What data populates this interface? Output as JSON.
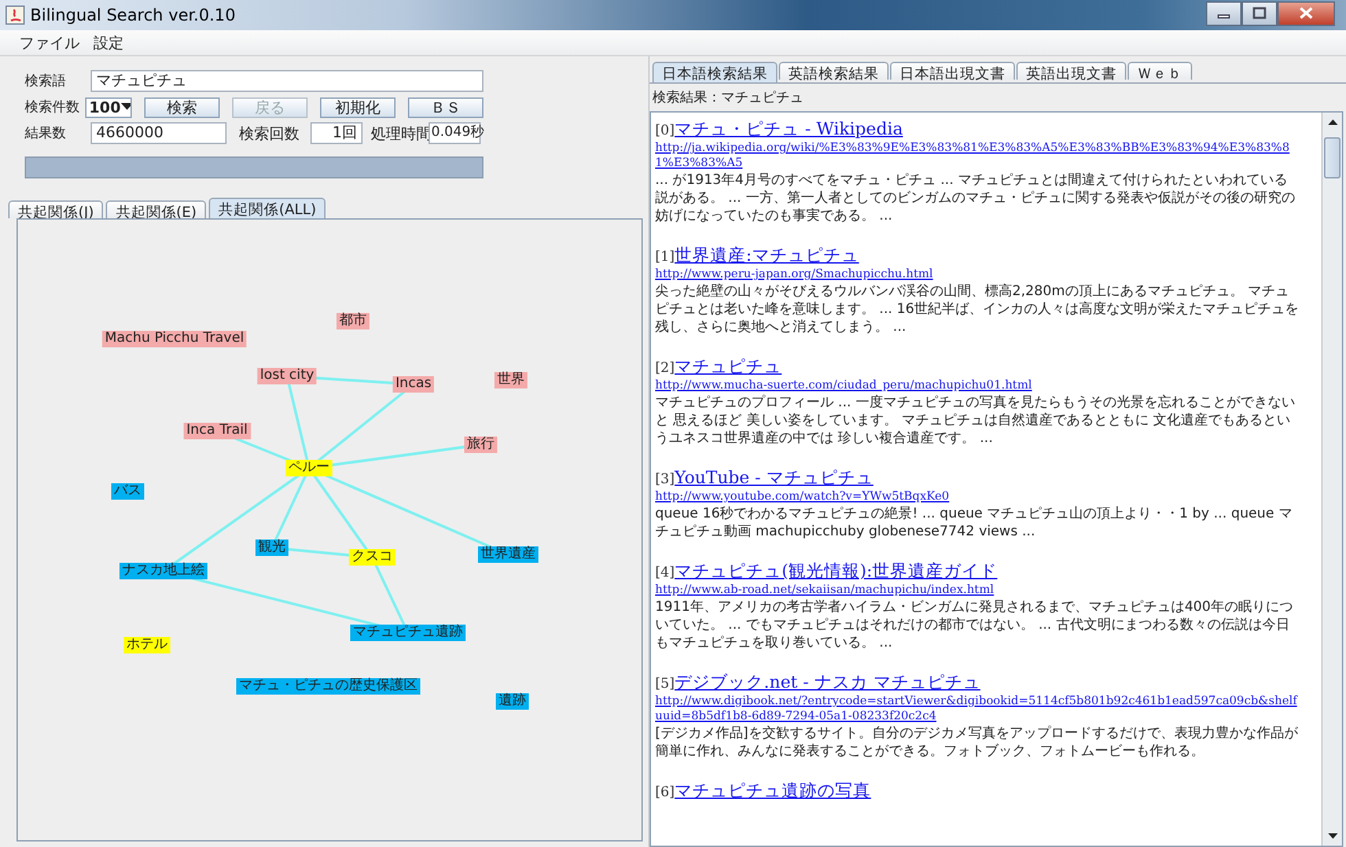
{
  "window": {
    "title": "Bilingual Search ver.0.10"
  },
  "menu": [
    "ファイル",
    "設定"
  ],
  "form": {
    "query_label": "検索語",
    "query": "マチュピチュ",
    "count_label": "検索件数",
    "count": "100",
    "buttons": [
      {
        "label": "検索",
        "disabled": false
      },
      {
        "label": "戻る",
        "disabled": true
      },
      {
        "label": "初期化",
        "disabled": false
      },
      {
        "label": "ＢＳ",
        "disabled": false
      }
    ],
    "results_label": "結果数",
    "results": "4660000",
    "searches_label": "検索回数",
    "searches": "1回",
    "time_label": "処理時間",
    "time": "0.049秒",
    "progress": {
      "level": 1
    }
  },
  "graph_tabs": [
    {
      "label": "共起関係(J)",
      "selected": false
    },
    {
      "label": "共起関係(E)",
      "selected": false
    },
    {
      "label": "共起関係(ALL)",
      "selected": true
    }
  ],
  "graph_nodes": [
    {
      "label": "Machu Picchu Travel",
      "color": "#f4aaaa"
    },
    {
      "label": "都市",
      "color": "#f4aaaa"
    },
    {
      "label": "lost city",
      "color": "#f4aaaa"
    },
    {
      "label": "Incas",
      "color": "#f4aaaa"
    },
    {
      "label": "世界",
      "color": "#f4aaaa"
    },
    {
      "label": "Inca Trail",
      "color": "#f4aaaa"
    },
    {
      "label": "旅行",
      "color": "#f4aaaa"
    },
    {
      "label": "ペルー",
      "color": "#ffff00"
    },
    {
      "label": "バス",
      "color": "#00b0f0"
    },
    {
      "label": "観光",
      "color": "#00b0f0"
    },
    {
      "label": "クスコ",
      "color": "#ffff00"
    },
    {
      "label": "世界遺産",
      "color": "#00b0f0"
    },
    {
      "label": "ナスカ地上絵",
      "color": "#00b0f0"
    },
    {
      "label": "マチュピチュ遺跡",
      "color": "#00b0f0"
    },
    {
      "label": "ホテル",
      "color": "#ffff00"
    },
    {
      "label": "マチュ・ピチュの歴史保護区",
      "color": "#00b0f0"
    },
    {
      "label": "遺跡",
      "color": "#00b0f0"
    }
  ],
  "result_tabs": [
    {
      "label": "日本語検索結果",
      "selected": true
    },
    {
      "label": "英語検索結果",
      "selected": false
    },
    {
      "label": "日本語出現文書",
      "selected": false
    },
    {
      "label": "英語出現文書",
      "selected": false
    },
    {
      "label": "Ｗｅｂ",
      "selected": false
    }
  ],
  "result_header": "検索結果：マチュピチュ",
  "results": [
    {
      "index": "[0]",
      "title": "マチュ・ピチュ - Wikipedia",
      "url": "http://ja.wikipedia.org/wiki/%E3%83%9E%E3%83%81%E3%83%A5%E3%83%BB%E3%83%94%E3%83%81%E3%83%A5",
      "snippet": "... が1913年4月号のすべてをマチュ・ピチュ ... マチュピチュとは間違えて付けられたといわれている説がある。 ... 一方、第一人者としてのビンガムのマチュ・ピチュに関する発表や仮説がその後の研究の妨げになっていたのも事実である。 ..."
    },
    {
      "index": "[1]",
      "title": "世界遺産:マチュピチュ",
      "url": "http://www.peru-japan.org/Smachupicchu.html",
      "snippet": "尖った絶壁の山々がそびえるウルバンバ渓谷の山間、標高2,280mの頂上にあるマチュピチュ。 マチュピチュとは老いた峰を意味します。 ... 16世紀半ば、インカの人々は高度な文明が栄えたマチュピチュを残し、さらに奥地へと消えてしまう。 ..."
    },
    {
      "index": "[2]",
      "title": "マチュピチュ",
      "url": "http://www.mucha-suerte.com/ciudad_peru/machupichu01.html",
      "snippet": "マチュピチュのプロフィール ... 一度マチュピチュの写真を見たらもうその光景を忘れることができないと 思えるほど 美しい姿をしています。 マチュピチュは自然遺産であるとともに 文化遺産でもあるというユネスコ世界遺産の中では 珍しい複合遺産です。 ..."
    },
    {
      "index": "[3]",
      "title": "YouTube - マチュピチュ",
      "url": "http://www.youtube.com/watch?v=YWw5tBqxKe0",
      "snippet": "queue 16秒でわかるマチュピチュの絶景! ... queue マチュピチュ山の頂上より・・1 by ... queue マチュピチュ動画 machupicchuby globenese7742 views ..."
    },
    {
      "index": "[4]",
      "title": "マチュピチュ(観光情報):世界遺産ガイド",
      "url": "http://www.ab-road.net/sekaiisan/machupichu/index.html",
      "snippet": "1911年、アメリカの考古学者ハイラム・ビンガムに発見されるまで、マチュピチュは400年の眠りについていた。 ... でもマチュピチュはそれだけの都市ではない。 ... 古代文明にまつわる数々の伝説は今日もマチュピチュを取り巻いている。 ..."
    },
    {
      "index": "[5]",
      "title": "デジブック.net - ナスカ マチュピチュ",
      "url": "http://www.digibook.net/?entrycode=startViewer&digibookid=5114cf5b801b92c461b1ead597ca09cb&shelfuuid=8b5df1b8-6d89-7294-05a1-08233f20c2c4",
      "snippet": "[デジカメ作品]を交歓するサイト。自分のデジカメ写真をアップロードするだけで、表現力豊かな作品が簡単に作れ、みんなに発表することができる。フォトブック、フォトムービーも作れる。"
    },
    {
      "index": "[6]",
      "title": "マチュピチュ遺跡の写真"
    }
  ]
}
